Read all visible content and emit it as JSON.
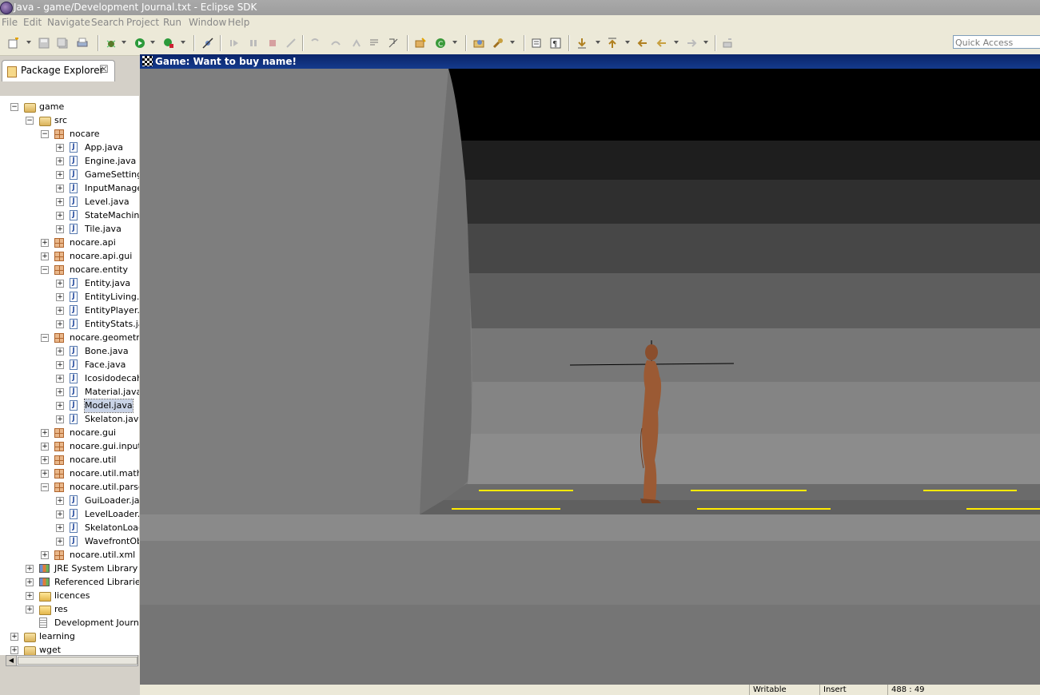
{
  "window": {
    "title": "Java - game/Development Journal.txt - Eclipse SDK"
  },
  "menu": [
    "File",
    "Edit",
    "Navigate",
    "Search",
    "Project",
    "Run",
    "Window",
    "Help"
  ],
  "toolbar": {
    "quick_access_placeholder": "Quick Access"
  },
  "package_explorer": {
    "tab_label": "Package Explorer",
    "tree": [
      {
        "label": "game",
        "icon": "project-icon",
        "expanded": true
      },
      {
        "label": "src",
        "icon": "source-folder-icon",
        "expanded": true
      },
      {
        "label": "nocare",
        "icon": "package-icon",
        "expanded": true
      },
      {
        "label": "App.java",
        "icon": "java-file-icon"
      },
      {
        "label": "Engine.java",
        "icon": "java-file-icon"
      },
      {
        "label": "GameSettings",
        "icon": "java-file-icon"
      },
      {
        "label": "InputManager",
        "icon": "java-file-icon"
      },
      {
        "label": "Level.java",
        "icon": "java-file-icon"
      },
      {
        "label": "StateMachine",
        "icon": "java-file-icon"
      },
      {
        "label": "Tile.java",
        "icon": "java-file-icon"
      },
      {
        "label": "nocare.api",
        "icon": "package-icon"
      },
      {
        "label": "nocare.api.gui",
        "icon": "package-icon"
      },
      {
        "label": "nocare.entity",
        "icon": "package-icon",
        "expanded": true
      },
      {
        "label": "Entity.java",
        "icon": "java-file-icon"
      },
      {
        "label": "EntityLiving.ja",
        "icon": "java-file-icon"
      },
      {
        "label": "EntityPlayer.j",
        "icon": "java-file-icon"
      },
      {
        "label": "EntityStats.ja",
        "icon": "java-file-icon"
      },
      {
        "label": "nocare.geometry",
        "icon": "package-icon",
        "expanded": true
      },
      {
        "label": "Bone.java",
        "icon": "java-file-icon"
      },
      {
        "label": "Face.java",
        "icon": "java-file-icon"
      },
      {
        "label": "Icosidodecahe",
        "icon": "java-file-icon"
      },
      {
        "label": "Material.java",
        "icon": "java-file-icon"
      },
      {
        "label": "Model.java",
        "icon": "java-file-icon",
        "selected": true
      },
      {
        "label": "Skelaton.java",
        "icon": "java-file-icon"
      },
      {
        "label": "nocare.gui",
        "icon": "package-icon"
      },
      {
        "label": "nocare.gui.input",
        "icon": "package-icon"
      },
      {
        "label": "nocare.util",
        "icon": "package-icon"
      },
      {
        "label": "nocare.util.math",
        "icon": "package-icon"
      },
      {
        "label": "nocare.util.parser",
        "icon": "package-icon",
        "expanded": true
      },
      {
        "label": "GuiLoader.jav",
        "icon": "java-file-icon"
      },
      {
        "label": "LevelLoader.j",
        "icon": "java-file-icon"
      },
      {
        "label": "SkelatonLoade",
        "icon": "java-file-icon"
      },
      {
        "label": "WavefrontOb",
        "icon": "java-file-icon"
      },
      {
        "label": "nocare.util.xml",
        "icon": "package-icon"
      },
      {
        "label": "JRE System Library [J",
        "icon": "library-icon"
      },
      {
        "label": "Referenced Libraries",
        "icon": "library-icon"
      },
      {
        "label": "licences",
        "icon": "folder-icon"
      },
      {
        "label": "res",
        "icon": "folder-icon"
      },
      {
        "label": "Development Journal.",
        "icon": "text-file-icon"
      },
      {
        "label": "learning",
        "icon": "project-icon"
      },
      {
        "label": "wget",
        "icon": "project-icon"
      }
    ]
  },
  "game_window": {
    "title": "Game: Want to buy name!"
  },
  "status": {
    "writable": "Writable",
    "insert": "Insert",
    "position": "488 : 49"
  }
}
